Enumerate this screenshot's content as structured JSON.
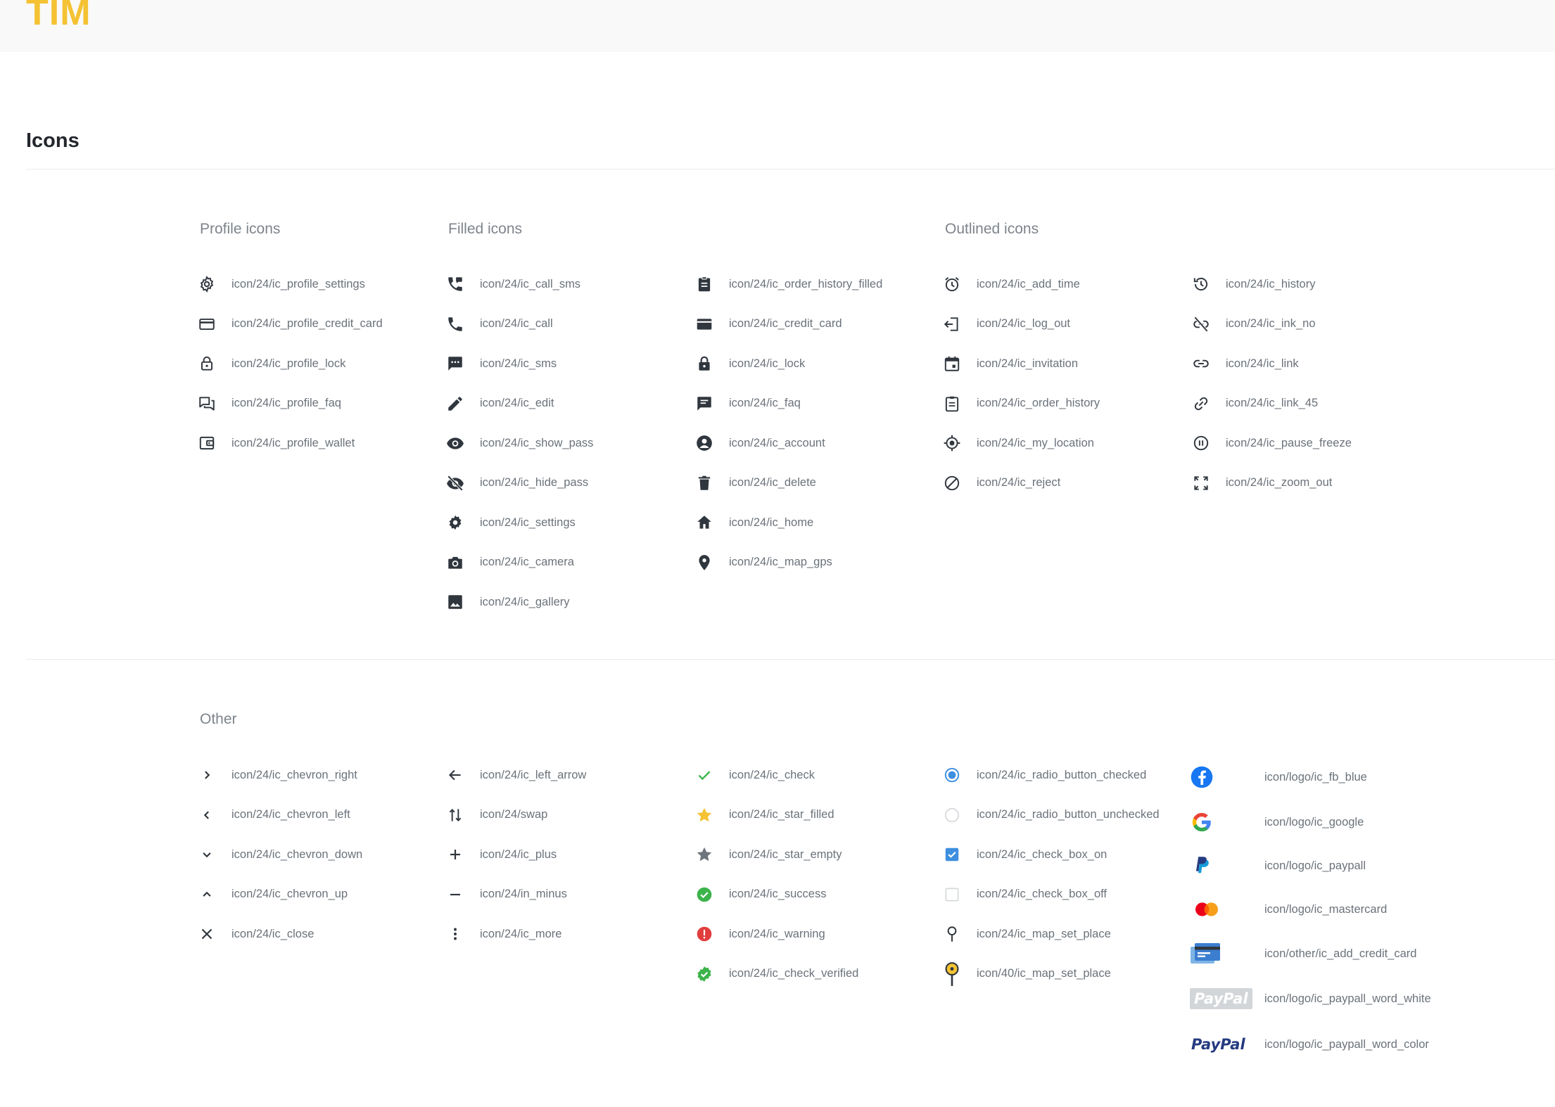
{
  "header": {
    "logo": "TIM"
  },
  "page": {
    "title": "Icons"
  },
  "sections": {
    "profile": "Profile icons",
    "filled": "Filled icons",
    "outlined": "Outlined icons",
    "other": "Other"
  },
  "colors": {
    "brand": "#f4c233",
    "text": "#30363d",
    "label": "#6b727a",
    "success": "#3cb44b",
    "warning": "#e23d3d",
    "accent_blue": "#3d8fe0",
    "star": "#f4c233"
  },
  "icons": {
    "profile": [
      {
        "icon": "gear-outline-icon",
        "label": "icon/24/ic_profile_settings"
      },
      {
        "icon": "credit-card-outline-icon",
        "label": "icon/24/ic_profile_credit_card"
      },
      {
        "icon": "lock-outline-icon",
        "label": "icon/24/ic_profile_lock"
      },
      {
        "icon": "chat-bubbles-icon",
        "label": "icon/24/ic_profile_faq"
      },
      {
        "icon": "wallet-icon",
        "label": "icon/24/ic_profile_wallet"
      }
    ],
    "filled_a": [
      {
        "icon": "call-sms-icon",
        "label": "icon/24/ic_call_sms"
      },
      {
        "icon": "phone-icon",
        "label": "icon/24/ic_call"
      },
      {
        "icon": "sms-icon",
        "label": "icon/24/ic_sms"
      },
      {
        "icon": "pencil-icon",
        "label": "icon/24/ic_edit"
      },
      {
        "icon": "eye-icon",
        "label": "icon/24/ic_show_pass"
      },
      {
        "icon": "eye-off-icon",
        "label": "icon/24/ic_hide_pass"
      },
      {
        "icon": "gear-icon",
        "label": "icon/24/ic_settings"
      },
      {
        "icon": "camera-icon",
        "label": "icon/24/ic_camera"
      },
      {
        "icon": "image-icon",
        "label": "icon/24/ic_gallery"
      }
    ],
    "filled_b": [
      {
        "icon": "clipboard-icon",
        "label": "icon/24/ic_order_history_filled"
      },
      {
        "icon": "credit-card-icon",
        "label": "icon/24/ic_credit_card"
      },
      {
        "icon": "lock-icon",
        "label": "icon/24/ic_lock"
      },
      {
        "icon": "chat-icon",
        "label": "icon/24/ic_faq"
      },
      {
        "icon": "account-icon",
        "label": "icon/24/ic_account"
      },
      {
        "icon": "trash-icon",
        "label": "icon/24/ic_delete"
      },
      {
        "icon": "home-icon",
        "label": "icon/24/ic_home"
      },
      {
        "icon": "map-pin-icon",
        "label": "icon/24/ic_map_gps"
      }
    ],
    "outlined_a": [
      {
        "icon": "alarm-icon",
        "label": "icon/24/ic_add_time"
      },
      {
        "icon": "log-out-icon",
        "label": "icon/24/ic_log_out"
      },
      {
        "icon": "calendar-icon",
        "label": "icon/24/ic_invitation"
      },
      {
        "icon": "clipboard-outline-icon",
        "label": "icon/24/ic_order_history"
      },
      {
        "icon": "my-location-icon",
        "label": "icon/24/ic_my_location"
      },
      {
        "icon": "block-icon",
        "label": "icon/24/ic_reject"
      }
    ],
    "outlined_b": [
      {
        "icon": "history-icon",
        "label": "icon/24/ic_history"
      },
      {
        "icon": "link-off-icon",
        "label": "icon/24/ic_ink_no"
      },
      {
        "icon": "link-icon",
        "label": "icon/24/ic_link"
      },
      {
        "icon": "link-45-icon",
        "label": "icon/24/ic_link_45"
      },
      {
        "icon": "pause-circle-icon",
        "label": "icon/24/ic_pause_freeze"
      },
      {
        "icon": "zoom-out-icon",
        "label": "icon/24/ic_zoom_out"
      }
    ],
    "other_a": [
      {
        "icon": "chevron-right-icon",
        "label": "icon/24/ic_chevron_right"
      },
      {
        "icon": "chevron-left-icon",
        "label": "icon/24/ic_chevron_left"
      },
      {
        "icon": "chevron-down-icon",
        "label": "icon/24/ic_chevron_down"
      },
      {
        "icon": "chevron-up-icon",
        "label": "icon/24/ic_chevron_up"
      },
      {
        "icon": "close-icon",
        "label": "icon/24/ic_close"
      }
    ],
    "other_b": [
      {
        "icon": "arrow-left-icon",
        "label": "icon/24/ic_left_arrow"
      },
      {
        "icon": "swap-icon",
        "label": "icon/24/swap"
      },
      {
        "icon": "plus-icon",
        "label": "icon/24/ic_plus"
      },
      {
        "icon": "minus-icon",
        "label": "icon/24/in_minus"
      },
      {
        "icon": "more-vertical-icon",
        "label": "icon/24/ic_more"
      }
    ],
    "other_c": [
      {
        "icon": "check-icon",
        "label": "icon/24/ic_check"
      },
      {
        "icon": "star-filled-icon",
        "label": "icon/24/ic_star_filled"
      },
      {
        "icon": "star-empty-icon",
        "label": "icon/24/ic_star_empty"
      },
      {
        "icon": "success-icon",
        "label": "icon/24/ic_success"
      },
      {
        "icon": "warning-icon",
        "label": "icon/24/ic_warning"
      },
      {
        "icon": "check-verified-icon",
        "label": "icon/24/ic_check_verified"
      }
    ],
    "other_d": [
      {
        "icon": "radio-checked-icon",
        "label": "icon/24/ic_radio_button_checked"
      },
      {
        "icon": "radio-unchecked-icon",
        "label": "icon/24/ic_radio_button_unchecked"
      },
      {
        "icon": "checkbox-on-icon",
        "label": "icon/24/ic_check_box_on"
      },
      {
        "icon": "checkbox-off-icon",
        "label": "icon/24/ic_check_box_off"
      },
      {
        "icon": "map-set-place-icon",
        "label": "icon/24/ic_map_set_place"
      },
      {
        "icon": "map-set-place-large-icon",
        "label": "icon/40/ic_map_set_place"
      }
    ],
    "logos": [
      {
        "icon": "facebook-logo-icon",
        "label": "icon/logo/ic_fb_blue"
      },
      {
        "icon": "google-logo-icon",
        "label": "icon/logo/ic_google"
      },
      {
        "icon": "paypal-logo-icon",
        "label": "icon/logo/ic_paypall"
      },
      {
        "icon": "mastercard-logo-icon",
        "label": "icon/logo/ic_mastercard"
      },
      {
        "icon": "add-credit-card-icon",
        "label": "icon/other/ic_add_credit_card"
      },
      {
        "icon": "paypal-word-white-icon",
        "label": "icon/logo/ic_paypall_word_white",
        "word": "PayPal"
      },
      {
        "icon": "paypal-word-color-icon",
        "label": "icon/logo/ic_paypall_word_color",
        "word": "PayPal"
      }
    ]
  }
}
